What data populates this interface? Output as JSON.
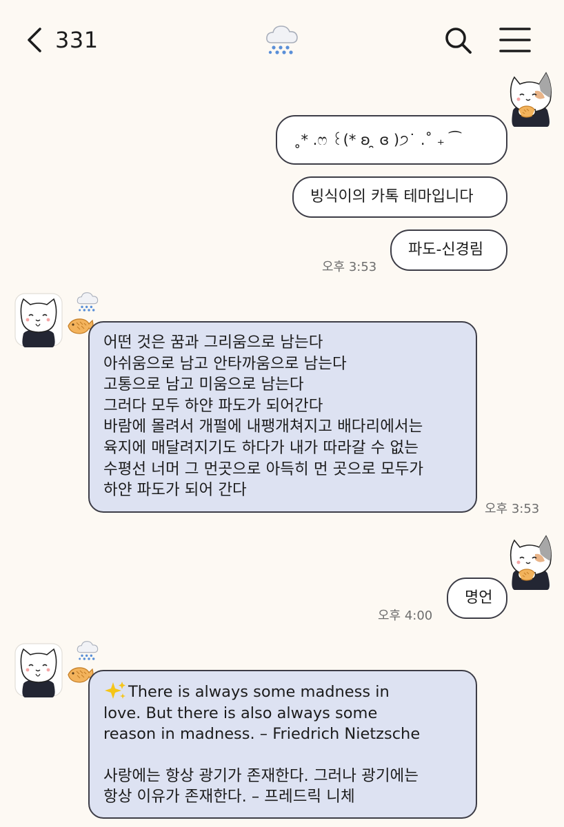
{
  "header": {
    "back_icon": "chevron-left-icon",
    "room_member_count": "331",
    "title_icon": "snow-cloud-icon",
    "search_icon": "search-icon",
    "menu_icon": "hamburger-menu-icon"
  },
  "colors": {
    "background": "#fdf9f3",
    "bubble_outline": "#3c3c46",
    "my_bubble": "#ffffff",
    "friend_bubble": "#dde2f2",
    "timestamp": "#6d6d6d"
  },
  "messages": [
    {
      "sender": "me",
      "avatar_icon": "calico-cat-avatar",
      "bubbles": [
        "˳* .ෆ ꒰(* ʚ ̯ ɞ )੭˙ .˚ ₊ ⁀",
        "빙식이의 카톡 테마입니다",
        "파도-신경림"
      ],
      "time": "오후 3:53"
    },
    {
      "sender": "friend",
      "avatar_icon": "white-cat-avatar",
      "badge_icons": [
        "snow-cloud-icon",
        "taiyaki-fish-icon"
      ],
      "lines": [
        "어떤 것은 꿈과 그리움으로 남는다",
        "아쉬움으로 남고 안타까움으로 남는다",
        "고통으로 남고 미움으로 남는다",
        "그러다 모두 하얀 파도가 되어간다",
        "바람에 몰려서 개펄에 내팽개쳐지고 배다리에서는",
        "육지에 매달려지기도 하다가 내가 따라갈 수 없는",
        "수평선 너머 그 먼곳으로 아득히 먼 곳으로 모두가",
        "하얀 파도가 되어 간다"
      ],
      "time": "오후 3:53"
    },
    {
      "sender": "me",
      "avatar_icon": "calico-cat-avatar",
      "bubbles": [
        "명언"
      ],
      "time": "오후 4:00"
    },
    {
      "sender": "friend",
      "avatar_icon": "white-cat-avatar",
      "badge_icons": [
        "snow-cloud-icon",
        "taiyaki-fish-icon"
      ],
      "sparkle_icon": "sparkles-icon",
      "lines": [
        "There is always some madness in",
        "love. But there is also always some",
        "reason in madness. – Friedrich Nietzsche",
        "",
        "사랑에는 항상 광기가 존재한다. 그러나 광기에는",
        "항상 이유가 존재한다. – 프레드릭 니체"
      ]
    }
  ]
}
